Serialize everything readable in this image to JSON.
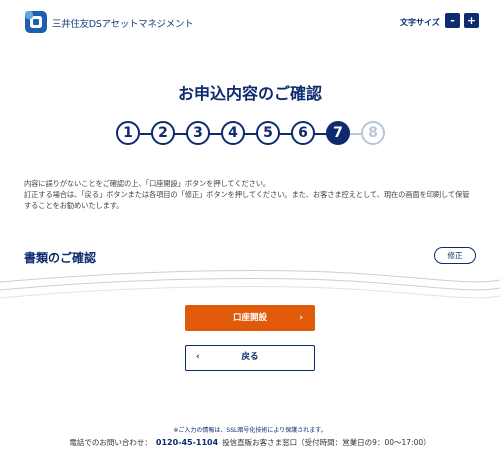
{
  "header": {
    "logo_text": "三井住友DSアセットマネジメント",
    "font_size_label": "文字サイズ",
    "font_minus": "-",
    "font_plus": "+",
    "brand_color": "#0d2b6e"
  },
  "main": {
    "title": "お申込内容のご確認",
    "steps": [
      {
        "label": "1",
        "state": "done"
      },
      {
        "label": "2",
        "state": "done"
      },
      {
        "label": "3",
        "state": "done"
      },
      {
        "label": "4",
        "state": "done"
      },
      {
        "label": "5",
        "state": "done"
      },
      {
        "label": "6",
        "state": "done"
      },
      {
        "label": "7",
        "state": "current"
      },
      {
        "label": "8",
        "state": "future"
      }
    ],
    "notice_line1": "内容に誤りがないことをご確認の上、「口座開設」ボタンを押してください。",
    "notice_line2": "訂正する場合は、「戻る」ボタンまたは各項目の「修正」ボタンを押してください。また、お客さま控えとして、現在の画面を印刷して保管することをお勧めいたします。"
  },
  "documents": {
    "section_title": "書類のご確認",
    "edit_label": "修正"
  },
  "actions": {
    "submit_label": "口座開設",
    "submit_chevron": "›",
    "back_label": "戻る",
    "back_chevron": "‹",
    "accent_color": "#e05a0a"
  },
  "footer": {
    "ssl_note": "※ご入力の情報は、SSL暗号化技術により保護されます。",
    "contact_prefix": "電話でのお問い合わせ：",
    "phone": "0120-45-1104",
    "contact_suffix": "投信直販お客さま窓口（受付時間：営業日の9：00〜17:00）"
  }
}
